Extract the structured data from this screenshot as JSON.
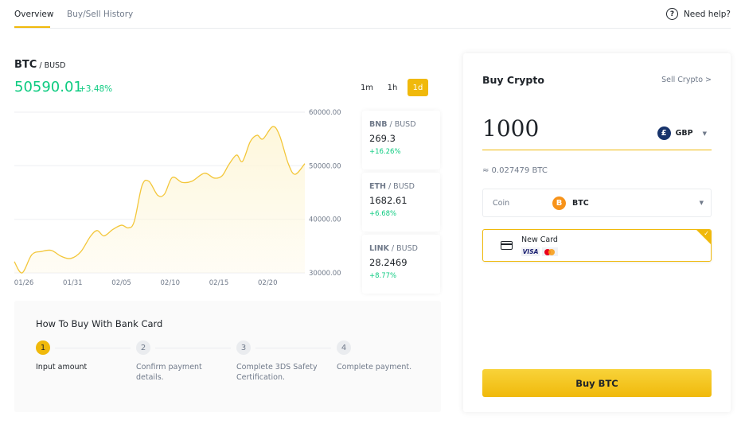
{
  "tabs": [
    {
      "label": "Overview",
      "active": true
    },
    {
      "label": "Buy/Sell History",
      "active": false
    }
  ],
  "help": {
    "icon": "question-circle-icon",
    "label": "Need help?"
  },
  "pair": {
    "base": "BTC",
    "separator": " / ",
    "quote": "BUSD",
    "price": "50590.01",
    "change": "+3.48%"
  },
  "intervals": [
    {
      "label": "1m",
      "active": false
    },
    {
      "label": "1h",
      "active": false
    },
    {
      "label": "1d",
      "active": true
    }
  ],
  "chart_data": {
    "type": "area",
    "title": "BTC / BUSD",
    "xlabel": "",
    "ylabel": "",
    "x_ticks": [
      "01/26",
      "01/31",
      "02/05",
      "02/10",
      "02/15",
      "02/20"
    ],
    "y_ticks": [
      "60000.00",
      "50000.00",
      "40000.00",
      "30000.00"
    ],
    "ylim": [
      30000,
      60000
    ],
    "grid": true,
    "y_axis_side": "right",
    "x_days": [
      -0.8,
      0,
      1,
      2,
      3,
      4,
      5,
      6,
      7,
      7.7,
      8.4,
      9.3,
      10.2,
      10.9,
      11.5,
      12.3,
      13.0,
      13.9,
      14.6,
      15.4,
      16.4,
      17.4,
      18.7,
      19.7,
      20.5,
      21.2,
      22.0,
      22.6,
      23.4,
      24.1,
      24.7,
      25.7,
      26.4,
      27.3,
      28.0,
      29.0
    ],
    "values": [
      32100,
      30000,
      33400,
      34000,
      34200,
      33100,
      32700,
      33900,
      36800,
      37900,
      36900,
      38100,
      38900,
      38400,
      39600,
      46300,
      47100,
      44500,
      44700,
      47800,
      46900,
      47100,
      48600,
      47700,
      48100,
      50200,
      52000,
      50800,
      54500,
      55700,
      55000,
      57300,
      55700,
      50400,
      48400,
      50400
    ],
    "day_offset_of_ticks": [
      0,
      5,
      10,
      15,
      20,
      25
    ],
    "line_color": "#f0b90b",
    "fill_color": "#fef6d8"
  },
  "tickers": [
    {
      "base": "BNB",
      "quote": "BUSD",
      "price": "269.3",
      "change": "+16.26%"
    },
    {
      "base": "ETH",
      "quote": "BUSD",
      "price": "1682.61",
      "change": "+6.68%"
    },
    {
      "base": "LINK",
      "quote": "BUSD",
      "price": "28.2469",
      "change": "+8.77%"
    }
  ],
  "howto": {
    "title": "How To Buy With Bank Card",
    "steps": [
      {
        "number": "1",
        "label": "Input amount",
        "active": true
      },
      {
        "number": "2",
        "label": "Confirm payment details.",
        "active": false
      },
      {
        "number": "3",
        "label": "Complete 3DS Safety Certification.",
        "active": false
      },
      {
        "number": "4",
        "label": "Complete payment.",
        "active": false
      }
    ]
  },
  "buy_panel": {
    "title": "Buy Crypto",
    "sell_link": "Sell Crypto >",
    "amount": "1000",
    "currency": {
      "symbol": "£",
      "label": "GBP",
      "icon": "gbp-icon"
    },
    "approx": "≈ 0.027479 BTC",
    "coin": {
      "label": "Coin",
      "symbol": "B",
      "value": "BTC",
      "icon": "btc-icon"
    },
    "payment": {
      "label": "New Card",
      "brands": [
        "VISA",
        "Mastercard"
      ],
      "selected": true
    },
    "buy_button": "Buy BTC"
  },
  "colors": {
    "accent": "#f0b90b",
    "positive": "#0ecb81",
    "text": "#1e2329",
    "muted": "#707a8a"
  }
}
